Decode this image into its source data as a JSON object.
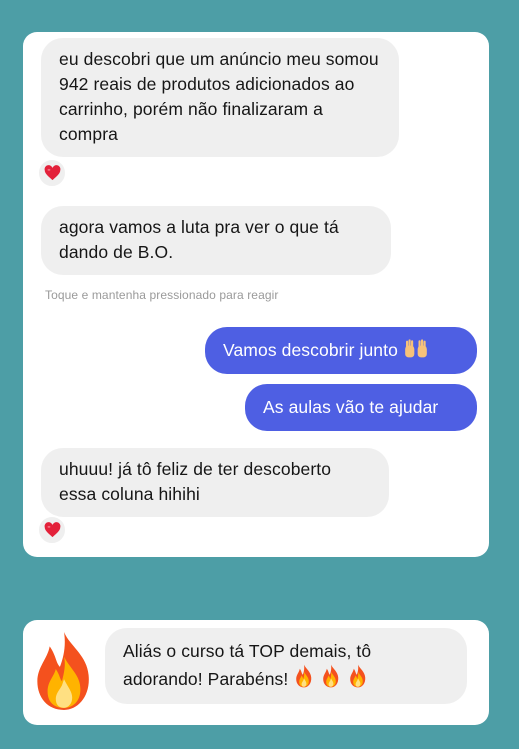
{
  "messages": {
    "m1": "eu descobri que um anúncio meu somou 942 reais de produtos adicionados ao carrinho, porém não finalizaram a compra",
    "m2": "agora vamos a luta pra ver o que tá dando de B.O.",
    "hint": "Toque e mantenha pressionado para reagir",
    "r1": "Vamos descobrir junto",
    "r2": "As aulas vão te ajudar",
    "m3": "uhuuu! já tô feliz de ter descoberto essa coluna hihihi",
    "m4": "Aliás o curso tá TOP demais, tô adorando! Parabéns!"
  },
  "icons": {
    "reaction": "red-heart-icon",
    "r1_emoji": "raising-hands-icon",
    "m4_emoji": "fire-icon",
    "big": "fire-icon"
  },
  "colors": {
    "background": "#4d9ea6",
    "incoming_bubble": "#efefef",
    "outgoing_bubble": "#4e5fe3"
  }
}
